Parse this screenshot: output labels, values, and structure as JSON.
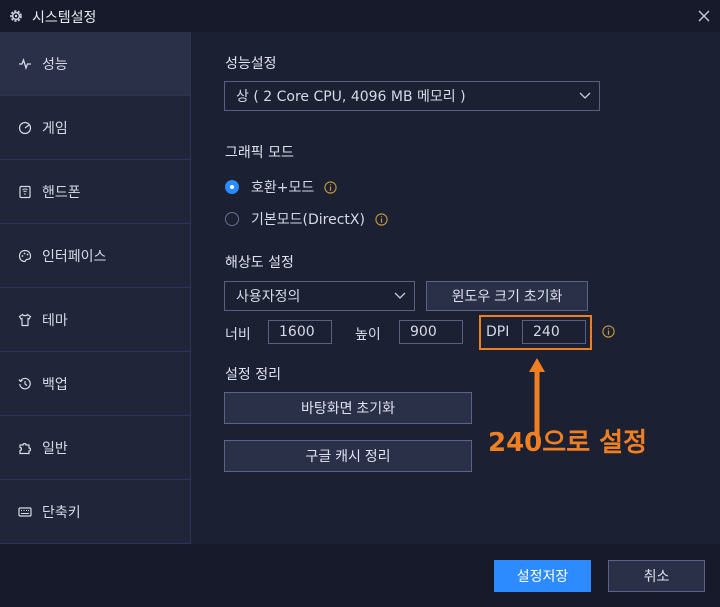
{
  "window": {
    "title": "시스템설정"
  },
  "sidebar": {
    "items": [
      {
        "label": "성능"
      },
      {
        "label": "게임"
      },
      {
        "label": "핸드폰"
      },
      {
        "label": "인터페이스"
      },
      {
        "label": "테마"
      },
      {
        "label": "백업"
      },
      {
        "label": "일반"
      },
      {
        "label": "단축키"
      }
    ]
  },
  "performance": {
    "title": "성능설정",
    "selected": "상 ( 2 Core CPU, 4096 MB 메모리 )"
  },
  "graphics": {
    "title": "그래픽 모드",
    "options": [
      {
        "label": "호환+모드",
        "checked": true
      },
      {
        "label": "기본모드(DirectX)",
        "checked": false
      }
    ]
  },
  "resolution": {
    "title": "해상도 설정",
    "preset": "사용자정의",
    "reset_window_label": "윈도우 크기 초기화",
    "width_label": "너비",
    "width_value": "1600",
    "height_label": "높이",
    "height_value": "900",
    "dpi_label": "DPI",
    "dpi_value": "240"
  },
  "cleanup": {
    "title": "설정 정리",
    "reset_desktop_label": "바탕화면 초기화",
    "clear_cache_label": "구글 캐시 정리"
  },
  "annotation": {
    "text": "240으로 설정"
  },
  "footer": {
    "save_label": "설정저장",
    "cancel_label": "취소"
  },
  "colors": {
    "accent": "#2b8bff",
    "highlight": "#f07f22",
    "background": "#1c2033"
  }
}
